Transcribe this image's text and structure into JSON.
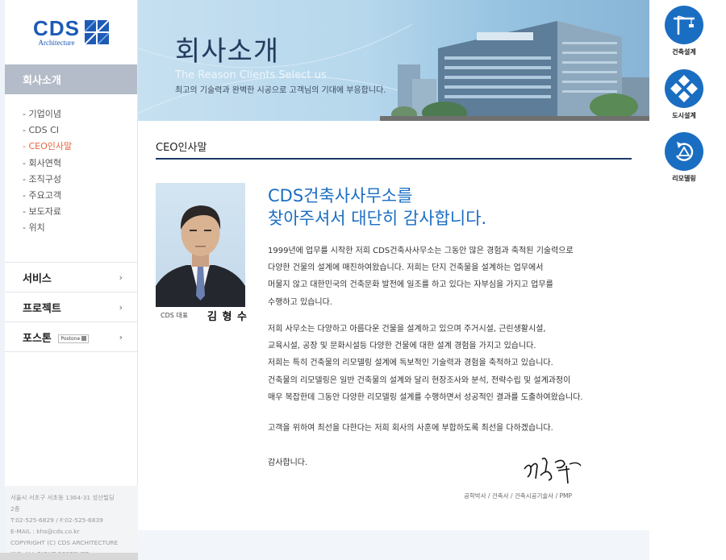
{
  "logo": {
    "name": "CDS",
    "sub": "Architecture"
  },
  "sidebar": {
    "section_title": "회사소개",
    "submenu": [
      {
        "label": "- 기업이념",
        "active": false
      },
      {
        "label": "- CDS CI",
        "active": false
      },
      {
        "label": "- CEO인사말",
        "active": true
      },
      {
        "label": "- 회사연혁",
        "active": false
      },
      {
        "label": "- 조직구성",
        "active": false
      },
      {
        "label": "- 주요고객",
        "active": false
      },
      {
        "label": "- 보도자료",
        "active": false
      },
      {
        "label": "- 위치",
        "active": false
      }
    ],
    "menu": [
      {
        "label": "서비스"
      },
      {
        "label": "프로젝트"
      },
      {
        "label": "포스톤",
        "badge": "Postone"
      }
    ],
    "chevron": "›"
  },
  "footer": {
    "lines": [
      "서울시 서초구 서초동 1364-31 성산빌딩",
      "2층",
      "T:02-525-6829 / F:02-525-6839",
      "E-MAIL : khs@cds.co.kr",
      "COPYRIGHT (C) CDS ARCHITECTURE",
      "INC. ALL RIGHT RESERVED"
    ]
  },
  "banner": {
    "title": "회사소개",
    "subtitle_en": "The Reason Clients Select us",
    "subtitle_ko": "최고의 기술력과 완벽한 시공으로 고객님의 기대에 부응합니다."
  },
  "content": {
    "heading": "CEO인사말",
    "ceo_caption": "CDS 대표",
    "ceo_name": "김 형 수",
    "headline_1": "CDS건축사사무소를",
    "headline_2": "찾아주셔서 대단히 감사합니다.",
    "p1": [
      "1999년에 업무를 시작한 저희 CDS건축사사무소는 그동안 많은 경험과 축적된 기술력으로",
      "다양한 건물의 설계에 매진하여왔습니다. 저희는 단지 건축물을 설계하는 업무에서",
      "머물지 않고 대한민국의 건축문화 발전에 일조를 하고 있다는 자부심을 가지고 업무를",
      "수행하고 있습니다."
    ],
    "p2": [
      "저희 사무소는 다양하고 아름다운 건물을 설계하고 있으며 주거시설, 근린생활시설,",
      "교육시설, 공장 및 문화시설등 다양한 건물에 대한 설계 경험을 가지고 있습니다.",
      "저희는 특히 건축물의 리모델링 설계에 독보적인 기술력과 경험을 축적하고 있습니다.",
      "건축물의 리모델링은 일반 건축물의 설계와 달리 현장조사와 분석, 전략수립 및 설계과정이",
      "매우 복잡한데 그동안 다양한 리모델링 설계를 수행하면서 성공적인 결과를 도출하여왔습니다."
    ],
    "p3": "고객을 위하여 최선을 다한다는 저희 회사의 사훈에 부합하도록 최선을 다하겠습니다.",
    "p4": "감사합니다.",
    "credentials": "공학박사 / 건축사 / 건축시공기술사 / PMP"
  },
  "services": [
    {
      "label": "건축설계",
      "icon": "crane-icon"
    },
    {
      "label": "도시설계",
      "icon": "city-grid-icon"
    },
    {
      "label": "리모델링",
      "icon": "remodel-icon"
    }
  ],
  "colors": {
    "brand_blue": "#1a6ec2",
    "active_orange": "#e8643c",
    "navy": "#1d3b66"
  }
}
